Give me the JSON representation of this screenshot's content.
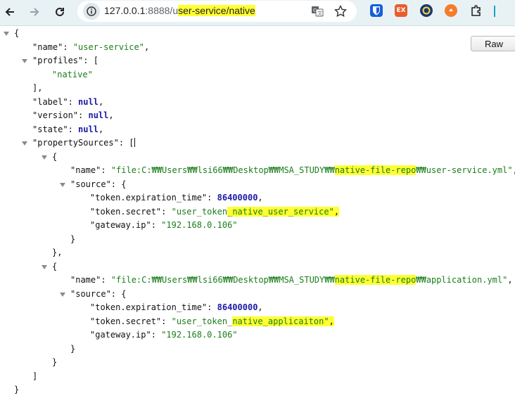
{
  "browser": {
    "url_host": "127.0.0.1",
    "url_port": ":8888/",
    "url_path_pre": "u",
    "url_path_hl": "ser-service/native",
    "ext_icons": [
      "bitwarden-icon",
      "ex-icon",
      "round-ext-icon",
      "orange-ext-icon",
      "puzzle-icon"
    ],
    "accent": "#1a73e8"
  },
  "raw_button": {
    "label": "Raw"
  },
  "json": {
    "name_key": "\"name\"",
    "name_val": "\"user-service\"",
    "profiles_key": "\"profiles\"",
    "profiles_val0": "\"native\"",
    "label_key": "\"label\"",
    "version_key": "\"version\"",
    "state_key": "\"state\"",
    "null_val": "null",
    "ps_key": "\"propertySources\"",
    "source_key": "\"source\"",
    "exp_key": "\"token.expiration_time\"",
    "secret_key": "\"token.secret\"",
    "gw_key": "\"gateway.ip\"",
    "ps0": {
      "name_pre": "\"file:C:₩₩Users₩₩lsi66₩₩Desktop₩₩MSA_STUDY₩₩",
      "name_hl": "native-file-repo",
      "name_post": "₩₩user-service.yml\"",
      "exp_val": "86400000",
      "secret_pre": "\"user_token",
      "secret_hl": "_native_user_service\"",
      "gw_val": "\"192.168.0.106\""
    },
    "ps1": {
      "name_pre": "\"file:C:₩₩Users₩₩lsi66₩₩Desktop₩₩MSA_STUDY₩₩",
      "name_hl": "native-file-repo",
      "name_post": "₩₩application.yml\"",
      "exp_val": "86400000",
      "secret_pre": "\"user_token_",
      "secret_hl": "native_applicaiton\"",
      "gw_val": "\"192.168.0.106\""
    }
  }
}
